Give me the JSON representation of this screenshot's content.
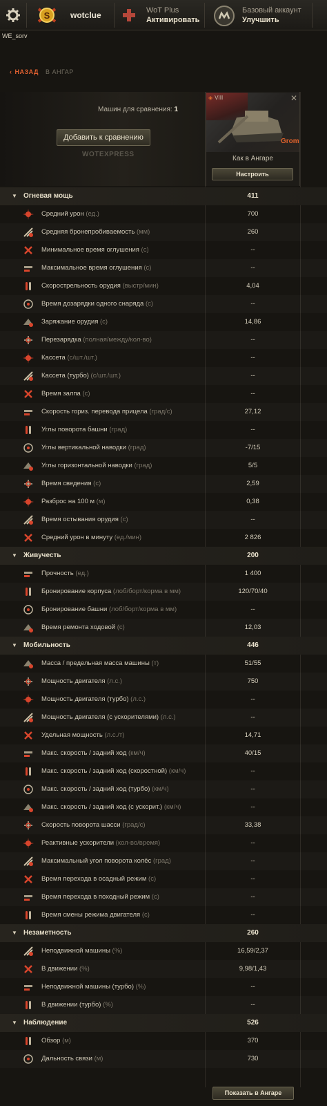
{
  "topbar": {
    "username": "wotclue",
    "wot_plus_title": "WoT Plus",
    "wot_plus_action": "Активировать",
    "account_title": "Базовый аккаунт",
    "account_action": "Улучшить"
  },
  "server": "WE_sorv",
  "nav": {
    "back": "НАЗАД",
    "back_target": "В АНГАР"
  },
  "compare": {
    "count_label": "Машин для сравнения:",
    "count": "1",
    "add_button": "Добавить к сравнению",
    "watermark": "WOTEXPRESS"
  },
  "tank": {
    "tier": "VIII",
    "name": "Grom",
    "config_label": "Как в Ангаре",
    "config_button": "Настроить",
    "flag_color": "#7a2c28",
    "name_color": "#e0622c"
  },
  "sections": [
    {
      "name": "Огневая мощь",
      "value": "411",
      "rows": [
        {
          "icon": "damage-icon",
          "label": "Средний урон",
          "unit": "(ед.)",
          "value": "700"
        },
        {
          "icon": "penetration-icon",
          "label": "Средняя бронепробиваемость",
          "unit": "(мм)",
          "value": "260"
        },
        {
          "icon": "stun-min-icon",
          "label": "Минимальное время оглушения",
          "unit": "(с)",
          "value": "--"
        },
        {
          "icon": "stun-max-icon",
          "label": "Максимальное время оглушения",
          "unit": "(с)",
          "value": "--"
        },
        {
          "icon": "rate-of-fire-icon",
          "label": "Скорострельность орудия",
          "unit": "(выстр/мин)",
          "value": "4,04"
        },
        {
          "icon": "shell-reload-icon",
          "label": "Время дозарядки одного снаряда",
          "unit": "(с)",
          "value": "--"
        },
        {
          "icon": "reload-icon",
          "label": "Заряжание орудия",
          "unit": "(с)",
          "value": "14,86"
        },
        {
          "icon": "autoreload-icon",
          "label": "Перезарядка",
          "unit": "(полная/между/кол-во)",
          "value": "--"
        },
        {
          "icon": "clip-icon",
          "label": "Кассета",
          "unit": "(с/шт./шт.)",
          "value": "--"
        },
        {
          "icon": "clip-turbo-icon",
          "label": "Кассета (турбо)",
          "unit": "(с/шт./шт.)",
          "value": "--"
        },
        {
          "icon": "salvo-icon",
          "label": "Время залпа",
          "unit": "(с)",
          "value": "--"
        },
        {
          "icon": "traverse-speed-icon",
          "label": "Скорость гориз. перевода прицела",
          "unit": "(град/с)",
          "value": "27,12"
        },
        {
          "icon": "turret-rotation-icon",
          "label": "Углы поворота башни",
          "unit": "(град)",
          "value": "--"
        },
        {
          "icon": "elevation-icon",
          "label": "Углы вертикальной наводки",
          "unit": "(град)",
          "value": "-7/15"
        },
        {
          "icon": "horizontal-arc-icon",
          "label": "Углы горизонтальной наводки",
          "unit": "(град)",
          "value": "5/5"
        },
        {
          "icon": "aim-time-icon",
          "label": "Время сведения",
          "unit": "(с)",
          "value": "2,59"
        },
        {
          "icon": "dispersion-icon",
          "label": "Разброс на 100 м",
          "unit": "(м)",
          "value": "0,38"
        },
        {
          "icon": "gun-cooldown-icon",
          "label": "Время остывания орудия",
          "unit": "(с)",
          "value": "--"
        },
        {
          "icon": "dpm-icon",
          "label": "Средний урон в минуту",
          "unit": "(ед./мин)",
          "value": "2 826"
        }
      ]
    },
    {
      "name": "Живучесть",
      "value": "200",
      "rows": [
        {
          "icon": "hit-points-icon",
          "label": "Прочность",
          "unit": "(ед.)",
          "value": "1 400"
        },
        {
          "icon": "hull-armor-icon",
          "label": "Бронирование корпуса",
          "unit": "(лоб/борт/корма в мм)",
          "value": "120/70/40"
        },
        {
          "icon": "turret-armor-icon",
          "label": "Бронирование башни",
          "unit": "(лоб/борт/корма в мм)",
          "value": "--"
        },
        {
          "icon": "repair-icon",
          "label": "Время ремонта ходовой",
          "unit": "(с)",
          "value": "12,03"
        }
      ]
    },
    {
      "name": "Мобильность",
      "value": "446",
      "rows": [
        {
          "icon": "weight-icon",
          "label": "Масса / предельная масса машины",
          "unit": "(т)",
          "value": "51/55"
        },
        {
          "icon": "engine-icon",
          "label": "Мощность двигателя",
          "unit": "(л.с.)",
          "value": "750"
        },
        {
          "icon": "engine-turbo-icon",
          "label": "Мощность двигателя (турбо)",
          "unit": "(л.с.)",
          "value": "--"
        },
        {
          "icon": "engine-boost-icon",
          "label": "Мощность двигателя (с ускорителями)",
          "unit": "(л.с.)",
          "value": "--"
        },
        {
          "icon": "power-ratio-icon",
          "label": "Удельная мощность",
          "unit": "(л.с./т)",
          "value": "14,71"
        },
        {
          "icon": "speed-icon",
          "label": "Макс. скорость / задний ход",
          "unit": "(км/ч)",
          "value": "40/15"
        },
        {
          "icon": "speed-fast-icon",
          "label": "Макс. скорость / задний ход (скоростной)",
          "unit": "(км/ч)",
          "value": "--"
        },
        {
          "icon": "speed-turbo-icon",
          "label": "Макс. скорость / задний ход (турбо)",
          "unit": "(км/ч)",
          "value": "--"
        },
        {
          "icon": "speed-boost-icon",
          "label": "Макс. скорость / задний ход (с ускорит.)",
          "unit": "(км/ч)",
          "value": "--"
        },
        {
          "icon": "hull-traverse-icon",
          "label": "Скорость поворота шасси",
          "unit": "(град/с)",
          "value": "33,38"
        },
        {
          "icon": "rocket-boost-icon",
          "label": "Реактивные ускорители",
          "unit": "(кол-во/время)",
          "value": "--"
        },
        {
          "icon": "wheel-angle-icon",
          "label": "Максимальный угол поворота колёс",
          "unit": "(град)",
          "value": "--"
        },
        {
          "icon": "siege-mode-icon",
          "label": "Время перехода в осадный режим",
          "unit": "(с)",
          "value": "--"
        },
        {
          "icon": "travel-mode-icon",
          "label": "Время перехода в походный режим",
          "unit": "(с)",
          "value": "--"
        },
        {
          "icon": "engine-mode-icon",
          "label": "Время смены режима двигателя",
          "unit": "(с)",
          "value": "--"
        }
      ]
    },
    {
      "name": "Незаметность",
      "value": "260",
      "rows": [
        {
          "icon": "camo-stationary-icon",
          "label": "Неподвижной машины",
          "unit": "(%)",
          "value": "16,59/2,37"
        },
        {
          "icon": "camo-moving-icon",
          "label": "В движении",
          "unit": "(%)",
          "value": "9,98/1,43"
        },
        {
          "icon": "camo-stationary-turbo-icon",
          "label": "Неподвижной машины (турбо)",
          "unit": "(%)",
          "value": "--"
        },
        {
          "icon": "camo-moving-turbo-icon",
          "label": "В движении (турбо)",
          "unit": "(%)",
          "value": "--"
        }
      ]
    },
    {
      "name": "Наблюдение",
      "value": "526",
      "rows": [
        {
          "icon": "view-range-icon",
          "label": "Обзор",
          "unit": "(м)",
          "value": "370"
        },
        {
          "icon": "radio-range-icon",
          "label": "Дальность связи",
          "unit": "(м)",
          "value": "730"
        }
      ]
    }
  ],
  "footer": {
    "show_in_hangar": "Показать в Ангаре"
  },
  "colors": {
    "accent": "#e0622c",
    "icon_red": "#d8452c"
  }
}
